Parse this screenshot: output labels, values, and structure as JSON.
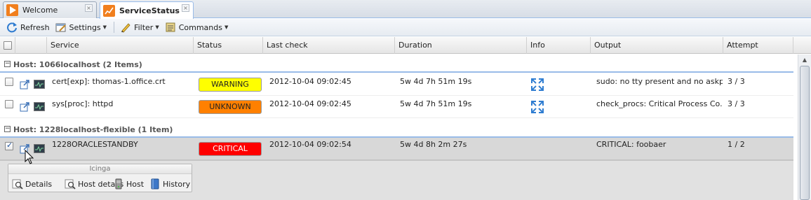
{
  "tabs": [
    {
      "label": "Welcome",
      "icon": "play-icon",
      "active": false
    },
    {
      "label": "ServiceStatus",
      "icon": "chart-icon",
      "active": true
    }
  ],
  "toolbar": {
    "refresh": "Refresh",
    "settings": "Settings",
    "filter": "Filter",
    "commands": "Commands"
  },
  "columns": {
    "service": "Service",
    "status": "Status",
    "last_check": "Last check",
    "duration": "Duration",
    "info": "Info",
    "output": "Output",
    "attempt": "Attempt"
  },
  "groups": [
    {
      "label": "Host: 1066localhost (2 Items)",
      "rows": [
        {
          "service": "cert[exp]: thomas-1.office.crt",
          "status": "WARNING",
          "last_check": "2012-10-04 09:02:45",
          "duration": "5w 4d 7h 51m 19s",
          "output": "sudo: no tty present and no askpa...",
          "attempt": "3 / 3",
          "checked": false
        },
        {
          "service": "sys[proc]: httpd",
          "status": "UNKNOWN",
          "last_check": "2012-10-04 09:02:45",
          "duration": "5w 4d 7h 51m 19s",
          "output": "check_procs: Critical Process Co...",
          "attempt": "3 / 3",
          "checked": false
        }
      ]
    },
    {
      "label": "Host: 1228localhost-flexible (1 Item)",
      "rows": [
        {
          "service": "1228ORACLESTANDBY",
          "status": "CRITICAL",
          "last_check": "2012-10-04 09:02:54",
          "duration": "5w 4d 8h 2m 27s",
          "output": "CRITICAL: foobaer",
          "attempt": "1 / 2",
          "checked": true
        }
      ]
    }
  ],
  "detail_panel": {
    "title": "Icinga",
    "actions": [
      "Details",
      "Host details",
      "Host",
      "History"
    ]
  },
  "colors": {
    "warning": "#ffff00",
    "unknown": "#ff8000",
    "critical": "#ff0000",
    "group_border": "#99bbe8"
  }
}
